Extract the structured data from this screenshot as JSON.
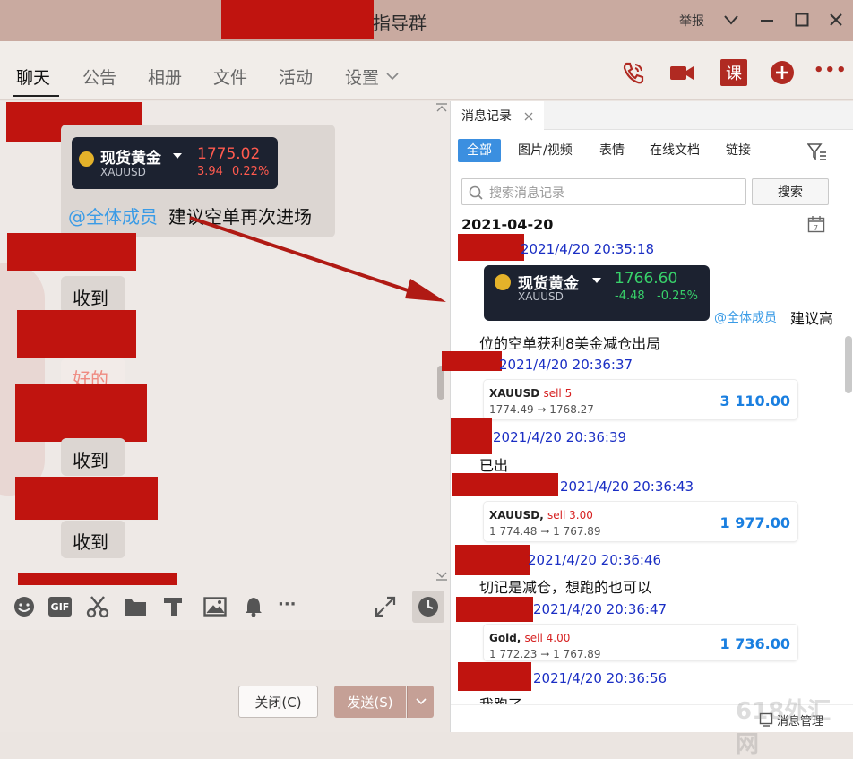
{
  "window": {
    "title": "指导群",
    "report_label": "举报",
    "watermark": "618外汇网"
  },
  "tabs": [
    {
      "label": "聊天"
    },
    {
      "label": "公告"
    },
    {
      "label": "相册"
    },
    {
      "label": "文件"
    },
    {
      "label": "活动"
    },
    {
      "label": "设置"
    }
  ],
  "toolbar": {
    "course_label": "课",
    "more_label": "•••"
  },
  "chat": {
    "quote": {
      "name": "现货黄金",
      "code": "XAUUSD",
      "price": "1775.02",
      "change": "3.94",
      "change_pct": "0.22%"
    },
    "mention": "@全体成员",
    "message": "建议空单再次进场",
    "replies": [
      "收到",
      "好的",
      "收到",
      "收到"
    ]
  },
  "composer": {
    "close_label": "关闭(C)",
    "send_label": "发送(S)"
  },
  "history": {
    "tab_label": "消息记录",
    "filters": [
      "全部",
      "图片/视频",
      "表情",
      "在线文档",
      "链接"
    ],
    "search_placeholder": "搜索消息记录",
    "search_button": "搜索",
    "date": "2021-04-20",
    "footer_label": "消息管理",
    "messages": [
      {
        "time": "2021/4/20 20:35:18",
        "quote": {
          "name": "现货黄金",
          "code": "XAUUSD",
          "price": "1766.60",
          "change": "-4.48",
          "change_pct": "-0.25%"
        },
        "mention": "@全体成员",
        "text_a": "建议高",
        "text_b": "位的空单获利8美金减仓出局"
      },
      {
        "time": "2021/4/20 20:36:37",
        "card": {
          "symbol": "XAUUSD",
          "side": "sell 5",
          "prices": "1774.49 → 1768.27",
          "profit": "3 110.00"
        }
      },
      {
        "time": "2021/4/20 20:36:39",
        "text": "已出"
      },
      {
        "time": "2021/4/20 20:36:43",
        "card": {
          "symbol": "XAUUSD,",
          "side": "sell 3.00",
          "prices": "1 774.48 → 1 767.89",
          "profit": "1 977.00"
        }
      },
      {
        "time": "2021/4/20 20:36:46",
        "text": "切记是减仓，想跑的也可以"
      },
      {
        "time": "2021/4/20 20:36:47",
        "card": {
          "symbol": "Gold,",
          "side": "sell 4.00",
          "prices": "1 772.23 → 1 767.89",
          "profit": "1 736.00"
        }
      },
      {
        "time": "2021/4/20 20:36:56",
        "text": "我跑了"
      }
    ]
  },
  "colors": {
    "redaction": "#c0140f",
    "accent_blue": "#3b8fe0",
    "timestamp_blue": "#1a2ec4",
    "quote_up": "#ff5a4e",
    "quote_down": "#38d16a",
    "profit_blue": "#1a7fe0"
  }
}
